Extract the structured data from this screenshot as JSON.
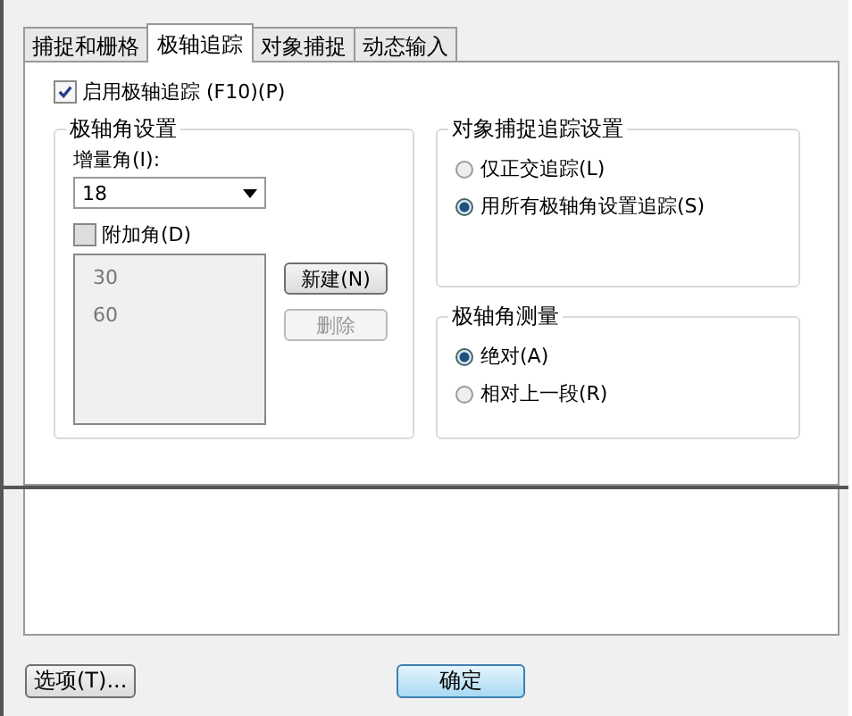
{
  "tabs": [
    {
      "label": "捕捉和栅格",
      "selected": false
    },
    {
      "label": "极轴追踪",
      "selected": true
    },
    {
      "label": "对象捕捉",
      "selected": false
    },
    {
      "label": "动态输入",
      "selected": false
    }
  ],
  "enable_tracking": {
    "label": "启用极轴追踪 (F10)(P)",
    "checked": true
  },
  "polar_settings": {
    "title": "极轴角设置",
    "increment_label": "增量角(I):",
    "increment_value": "18",
    "additional": {
      "label": "附加角(D)",
      "checked": false
    },
    "angles": [
      "30",
      "60"
    ],
    "buttons": [
      {
        "label": "新建(N)",
        "disabled": false
      },
      {
        "label": "删除",
        "disabled": true
      }
    ]
  },
  "tracking_settings": {
    "title": "对象捕捉追踪设置",
    "options": [
      {
        "label": "仅正交追踪(L)",
        "selected": false
      },
      {
        "label": "用所有极轴角设置追踪(S)",
        "selected": true
      }
    ]
  },
  "measurement": {
    "title": "极轴角测量",
    "options": [
      {
        "label": "绝对(A)",
        "selected": true
      },
      {
        "label": "相对上一段(R)",
        "selected": false
      }
    ]
  },
  "footer": {
    "options_button": "选项(T)...",
    "ok_button": "确定"
  }
}
